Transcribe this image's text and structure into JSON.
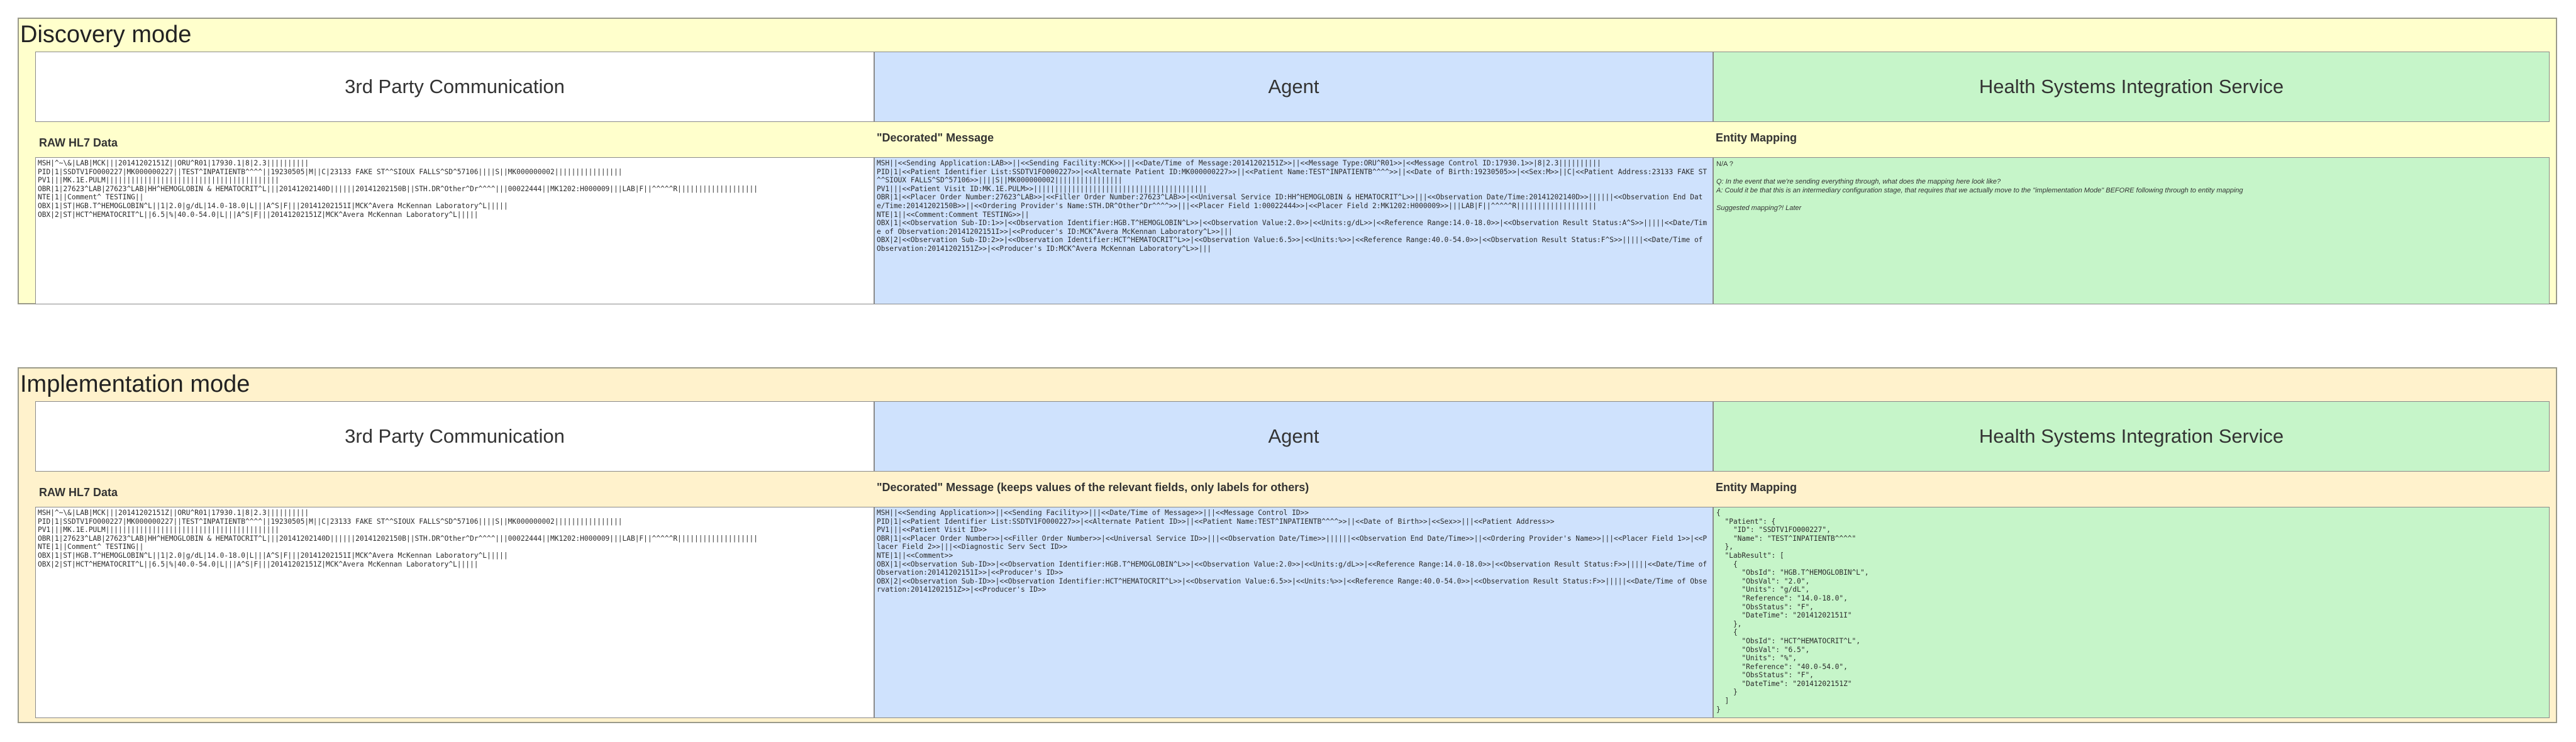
{
  "discovery": {
    "title": "Discovery mode",
    "columns": {
      "third_party": "3rd Party Communication",
      "agent": "Agent",
      "hsis": "Health Systems Integration Service"
    },
    "raw_label": "RAW HL7 Data",
    "decorated_label": "\"Decorated\" Message",
    "mapping_label": "Entity Mapping",
    "raw_hl7": "MSH|^~\\&|LAB|MCK|||20141202151Z||ORU^R01|17930.1|8|2.3||||||||||\nPID|1|SSDTV1FO000227|MK000000227||TEST^INPATIENTB^^^^||19230505|M||C|23133 FAKE ST^^SIOUX FALLS^SD^57106||||S||MK000000002||||||||||||||||\nPV1|||MK.1E.PULM|||||||||||||||||||||||||||||||||||||||||\nOBR|1|27623^LAB|27623^LAB|HH^HEMOGLOBIN & HEMATOCRIT^L|||20141202140D||||||20141202150B||STH.DR^Other^Dr^^^^|||00022444||MK1202:H000009|||LAB|F||^^^^^R|||||||||||||||||||\nNTE|1||Comment^ TESTING||\nOBX|1|ST|HGB.T^HEMOGLOBIN^L||1|2.0|g/dL|14.0-18.0|L|||A^S|F|||20141202151I|MCK^Avera McKennan Laboratory^L|||||\nOBX|2|ST|HCT^HEMATOCRIT^L||6.5|%|40.0-54.0|L|||A^S|F|||20141202151Z|MCK^Avera McKennan Laboratory^L|||||",
    "decorated": "MSH||<<Sending Application:LAB>>||<<Sending Facility:MCK>>|||<<Date/Time of Message:20141202151Z>>||<<Message Type:ORU^R01>>|<<Message Control ID:17930.1>>|8|2.3||||||||||\nPID|1|<<Patient Identifier List:SSDTV1FO000227>>|<<Alternate Patient ID:MK000000227>>||<<Patient Name:TEST^INPATIENTB^^^^>>||<<Date of Birth:19230505>>|<<Sex:M>>||C|<<Patient Address:23133 FAKE ST^^SIOUX FALLS^SD^57106>>||||S||MK000000002||||||||||||||||\nPV1|||<<Patient Visit ID:MK.1E.PULM>>|||||||||||||||||||||||||||||||||||||||||\nOBR|1|<<Placer Order Number:27623^LAB>>|<<Filler Order Number:27623^LAB>>|<<Universal Service ID:HH^HEMOGLOBIN & HEMATOCRIT^L>>|||<<Observation Date/Time:20141202140D>>||||||<<Observation End Date/Time:20141202150B>>||<<Ordering Provider's Name:STH.DR^Other^Dr^^^^>>|||<<Placer Field 1:00022444>>|<<Placer Field 2:MK1202:H000009>>|||LAB|F||^^^^^R|||||||||||||||||||\nNTE|1||<<Comment:Comment TESTING>>||\nOBX|1|<<Observation Sub-ID:1>>|<<Observation Identifier:HGB.T^HEMOGLOBIN^L>>|<<Observation Value:2.0>>|<<Units:g/dL>>|<<Reference Range:14.0-18.0>>|<<Observation Result Status:A^S>>|||||<<Date/Time of Observation:20141202151I>>|<<Producer's ID:MCK^Avera McKennan Laboratory^L>>|||\nOBX|2|<<Observation Sub-ID:2>>|<<Observation Identifier:HCT^HEMATOCRIT^L>>|<<Observation Value:6.5>>|<<Units:%>>|<<Reference Range:40.0-54.0>>|<<Observation Result Status:F^S>>|||||<<Date/Time of Observation:20141202151Z>>|<<Producer's ID:MCK^Avera McKennan Laboratory^L>>|||",
    "mapping_note": {
      "na": "N/A ?",
      "q": "Q: In the event that we're sending everything through, what does the mapping here look like?",
      "a": "A: Could it be that this is an intermediary configuration stage, that requires that we actually move to the \"implementation Mode\" BEFORE following through to entity mapping",
      "suggested": "Suggested mapping?! Later"
    }
  },
  "implementation": {
    "title": "Implementation mode",
    "columns": {
      "third_party": "3rd Party Communication",
      "agent": "Agent",
      "hsis": "Health Systems Integration Service"
    },
    "raw_label": "RAW HL7 Data",
    "decorated_label": "\"Decorated\" Message (keeps values of the relevant fields, only labels for others)",
    "mapping_label": "Entity Mapping",
    "raw_hl7": "MSH|^~\\&|LAB|MCK|||20141202151Z||ORU^R01|17930.1|8|2.3||||||||||\nPID|1|SSDTV1FO000227|MK000000227||TEST^INPATIENTB^^^^||19230505|M||C|23133 FAKE ST^^SIOUX FALLS^SD^57106||||S||MK000000002||||||||||||||||\nPV1|||MK.1E.PULM|||||||||||||||||||||||||||||||||||||||||\nOBR|1|27623^LAB|27623^LAB|HH^HEMOGLOBIN & HEMATOCRIT^L|||20141202140D||||||20141202150B||STH.DR^Other^Dr^^^^|||00022444||MK1202:H000009|||LAB|F||^^^^^R|||||||||||||||||||\nNTE|1||Comment^ TESTING||\nOBX|1|ST|HGB.T^HEMOGLOBIN^L||1|2.0|g/dL|14.0-18.0|L|||A^S|F|||20141202151I|MCK^Avera McKennan Laboratory^L|||||\nOBX|2|ST|HCT^HEMATOCRIT^L||6.5|%|40.0-54.0|L|||A^S|F|||20141202151Z|MCK^Avera McKennan Laboratory^L|||||",
    "decorated": "MSH||<<Sending Application>>||<<Sending Facility>>|||<<Date/Time of Message>>|||<<Message Control ID>>\nPID|1|<<Patient Identifier List:SSDTV1FO000227>>|<<Alternate Patient ID>>||<<Patient Name:TEST^INPATIENTB^^^^>>||<<Date of Birth>>|<<Sex>>|||<<Patient Address>>\nPV1|||<<Patient Visit ID>>\nOBR|1|<<Placer Order Number>>|<<Filler Order Number>>|<<Universal Service ID>>|||<<Observation Date/Time>>||||||<<Observation End Date/Time>>||<<Ordering Provider's Name>>|||<<Placer Field 1>>|<<Placer Field 2>>|||<<Diagnostic Serv Sect ID>>\nNTE|1||<<Comment>>\nOBX|1|<<Observation Sub-ID>>|<<Observation Identifier:HGB.T^HEMOGLOBIN^L>>|<<Observation Value:2.0>>|<<Units:g/dL>>|<<Reference Range:14.0-18.0>>|<<Observation Result Status:F>>|||||<<Date/Time of Observation:20141202151I>>|<<Producer's ID>>\nOBX|2|<<Observation Sub-ID>>|<<Observation Identifier:HCT^HEMATOCRIT^L>>|<<Observation Value:6.5>>|<<Units:%>>|<<Reference Range:40.0-54.0>>|<<Observation Result Status:F>>|||||<<Date/Time of Observation:20141202151Z>>|<<Producer's ID>>",
    "mapping_json": "{\n  \"Patient\": {\n    \"ID\": \"SSDTV1FO000227\",\n    \"Name\": \"TEST^INPATIENTB^^^^\"\n  },\n  \"LabResult\": [\n    {\n      \"ObsId\": \"HGB.T^HEMOGLOBIN^L\",\n      \"ObsVal\": \"2.0\",\n      \"Units\": \"g/dL\",\n      \"Reference\": \"14.0-18.0\",\n      \"ObsStatus\": \"F\",\n      \"DateTime\": \"20141202151I\"\n    },\n    {\n      \"ObsId\": \"HCT^HEMATOCRIT^L\",\n      \"ObsVal\": \"6.5\",\n      \"Units\": \"%\",\n      \"Reference\": \"40.0-54.0\",\n      \"ObsStatus\": \"F\",\n      \"DateTime\": \"20141202151Z\"\n    }\n  ]\n}"
  }
}
